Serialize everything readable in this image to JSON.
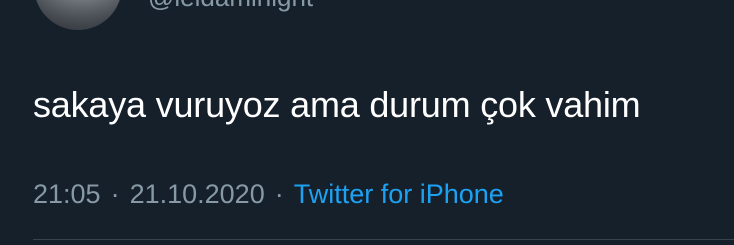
{
  "tweet": {
    "handle": "@leidaminight",
    "text": "sakaya vuruyoz ama durum çok vahim",
    "time": "21:05",
    "separator": "·",
    "date": "21.10.2020",
    "source": "Twitter for iPhone"
  },
  "colors": {
    "background": "#15202b",
    "text": "#ffffff",
    "muted": "#8899a6",
    "accent": "#1da1f2",
    "divider": "#38444d"
  }
}
